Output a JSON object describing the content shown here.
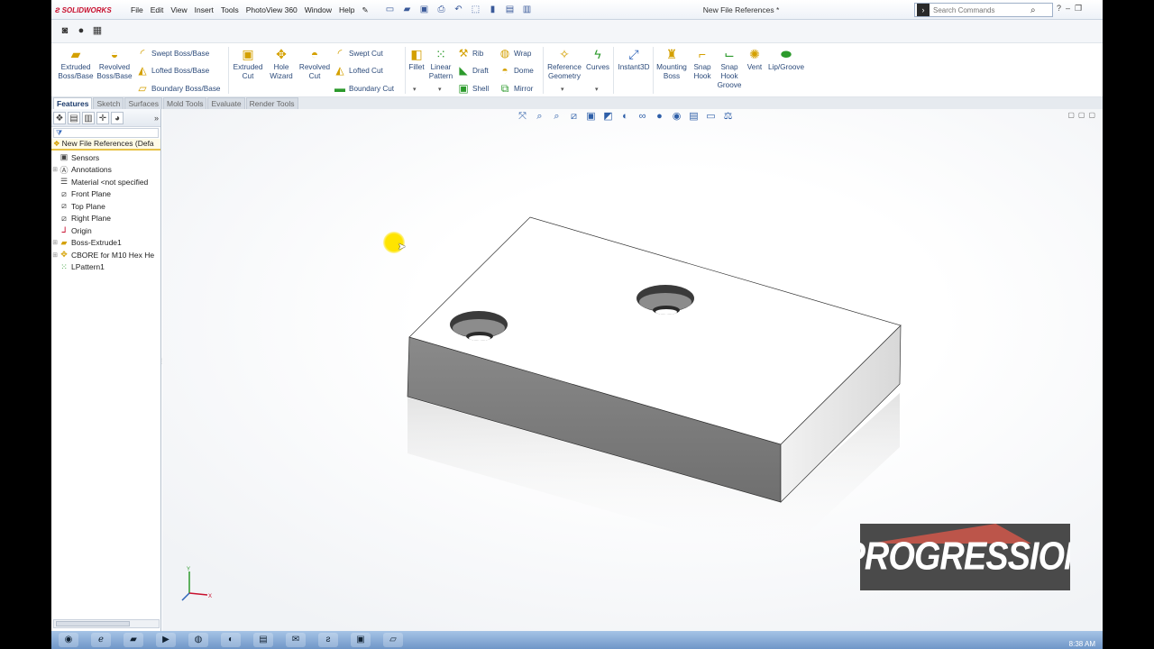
{
  "app": {
    "brand": "SOLIDWORKS",
    "menus": [
      "File",
      "Edit",
      "View",
      "Insert",
      "Tools",
      "PhotoView 360",
      "Window",
      "Help"
    ],
    "document_title": "New File References *",
    "search_placeholder": "Search Commands"
  },
  "ribbon": {
    "extruded_boss": "Extruded\nBoss/Base",
    "revolved_boss": "Revolved\nBoss/Base",
    "swept_boss": "Swept Boss/Base",
    "lofted_boss": "Lofted Boss/Base",
    "boundary_boss": "Boundary Boss/Base",
    "extruded_cut": "Extruded\nCut",
    "hole_wizard": "Hole\nWizard",
    "revolved_cut": "Revolved\nCut",
    "swept_cut": "Swept Cut",
    "lofted_cut": "Lofted Cut",
    "boundary_cut": "Boundary Cut",
    "fillet": "Fillet",
    "linear_pattern": "Linear\nPattern",
    "rib": "Rib",
    "draft": "Draft",
    "shell": "Shell",
    "wrap": "Wrap",
    "dome": "Dome",
    "mirror": "Mirror",
    "reference_geometry": "Reference\nGeometry",
    "curves": "Curves",
    "instant3d": "Instant3D",
    "mounting_boss": "Mounting\nBoss",
    "snap_hook": "Snap\nHook",
    "snap_hook_groove": "Snap\nHook\nGroove",
    "vent": "Vent",
    "lip_groove": "Lip/Groove"
  },
  "tabs": [
    "Features",
    "Sketch",
    "Surfaces",
    "Mold Tools",
    "Evaluate",
    "Render Tools"
  ],
  "feature_tree": {
    "root": "New File References  (Defa",
    "items": [
      {
        "label": "Sensors",
        "icon": "sensor-icon"
      },
      {
        "label": "Annotations",
        "icon": "annotation-icon"
      },
      {
        "label": "Material <not specified",
        "icon": "material-icon"
      },
      {
        "label": "Front Plane",
        "icon": "plane-icon"
      },
      {
        "label": "Top Plane",
        "icon": "plane-icon"
      },
      {
        "label": "Right Plane",
        "icon": "plane-icon"
      },
      {
        "label": "Origin",
        "icon": "origin-icon"
      },
      {
        "label": "Boss-Extrude1",
        "icon": "extrude-icon"
      },
      {
        "label": "CBORE for M10 Hex He",
        "icon": "hole-icon"
      },
      {
        "label": "LPattern1",
        "icon": "pattern-icon"
      }
    ]
  },
  "watermark": "PROGRESSION",
  "clock": "8:38 AM",
  "colors": {
    "accent": "#2e63b8",
    "brand_red": "#c8102e",
    "part_top": "#ffffff",
    "part_side": "#7f7f7f",
    "part_end": "#e9e9e9"
  }
}
